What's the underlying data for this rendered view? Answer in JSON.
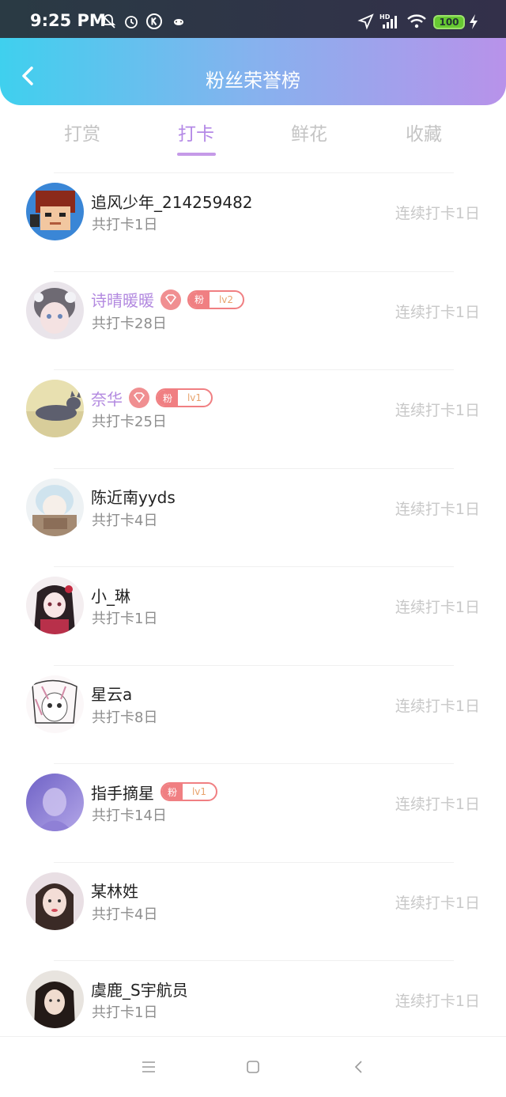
{
  "status_bar": {
    "time": "9:25 PM",
    "battery": "100",
    "network": "HD"
  },
  "header": {
    "title": "粉丝荣誉榜"
  },
  "tabs": [
    {
      "label": "打赏",
      "active": false
    },
    {
      "label": "打卡",
      "active": true
    },
    {
      "label": "鲜花",
      "active": false
    },
    {
      "label": "收藏",
      "active": false
    }
  ],
  "list": [
    {
      "name": "追风少年_214259482",
      "vip": false,
      "gem": false,
      "fan_level": "",
      "total": "共打卡1日",
      "streak": "连续打卡1日"
    },
    {
      "name": "诗晴暖暖",
      "vip": true,
      "gem": true,
      "fan_level": "lv2",
      "total": "共打卡28日",
      "streak": "连续打卡1日"
    },
    {
      "name": "奈华",
      "vip": true,
      "gem": true,
      "fan_level": "lv1",
      "total": "共打卡25日",
      "streak": "连续打卡1日"
    },
    {
      "name": "陈近南yyds",
      "vip": false,
      "gem": false,
      "fan_level": "",
      "total": "共打卡4日",
      "streak": "连续打卡1日"
    },
    {
      "name": "小_琳",
      "vip": false,
      "gem": false,
      "fan_level": "",
      "total": "共打卡1日",
      "streak": "连续打卡1日"
    },
    {
      "name": "星云a",
      "vip": false,
      "gem": false,
      "fan_level": "",
      "total": "共打卡8日",
      "streak": "连续打卡1日"
    },
    {
      "name": "指手摘星",
      "vip": false,
      "gem": false,
      "fan_level": "lv1",
      "total": "共打卡14日",
      "streak": "连续打卡1日"
    },
    {
      "name": "某林姓",
      "vip": false,
      "gem": false,
      "fan_level": "",
      "total": "共打卡4日",
      "streak": "连续打卡1日"
    },
    {
      "name": "虞鹿_S宇航员",
      "vip": false,
      "gem": false,
      "fan_level": "",
      "total": "共打卡1日",
      "streak": "连续打卡1日"
    }
  ],
  "fan_badge_char": "粉",
  "colors": {
    "accent": "#b489e6",
    "badge": "#f07f82"
  }
}
